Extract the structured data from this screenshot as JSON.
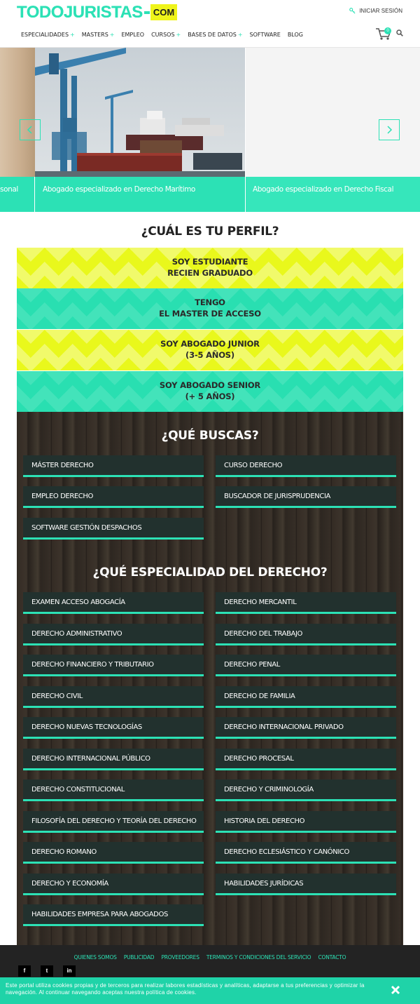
{
  "header": {
    "logo_main": "TODOJURISTAS",
    "logo_com": "COM",
    "login_label": "INICIAR SESIÓN",
    "cart_count": "0",
    "nav": [
      {
        "label": "ESPECIALIDADES",
        "plus": "+"
      },
      {
        "label": "MASTERS",
        "plus": "+"
      },
      {
        "label": "EMPLEO",
        "plus": ""
      },
      {
        "label": "CURSOS",
        "plus": "+"
      },
      {
        "label": "BASES DE DATOS",
        "plus": "+"
      },
      {
        "label": "SOFTWARE",
        "plus": ""
      },
      {
        "label": "BLOG",
        "plus": ""
      }
    ]
  },
  "slider": {
    "left_caption": "sonal",
    "main_caption": "Abogado especializado en Derecho Marítimo",
    "right_caption": "Abogado especializado en Derecho Fiscal"
  },
  "perfil": {
    "title": "¿CUÁL ES TU PERFIL?",
    "options": [
      {
        "line1": "SOY ESTUDIANTE",
        "line2": "RECIEN GRADUADO"
      },
      {
        "line1": "TENGO",
        "line2": "EL MASTER DE ACCESO"
      },
      {
        "line1": "SOY ABOGADO JUNIOR",
        "line2": "(3-5 AÑOS)"
      },
      {
        "line1": "SOY ABOGADO SENIOR",
        "line2": "(+ 5 AÑOS)"
      }
    ]
  },
  "buscas": {
    "title": "¿QUÉ BUSCAS?",
    "items": [
      "MÁSTER DERECHO",
      "CURSO DERECHO",
      "EMPLEO DERECHO",
      "BUSCADOR DE JURISPRUDENCIA",
      "SOFTWARE GESTIÓN DESPACHOS"
    ]
  },
  "especialidad": {
    "title": "¿QUÉ ESPECIALIDAD DEL DERECHO?",
    "items": [
      "EXAMEN ACCESO ABOGACÍA",
      "DERECHO MERCANTIL",
      "DERECHO ADMINISTRATIVO",
      "DERECHO DEL TRABAJO",
      "DERECHO FINANCIERO Y TRIBUTARIO",
      "DERECHO PENAL",
      "DERECHO CIVIL",
      "DERECHO DE FAMILIA",
      "DERECHO NUEVAS TECNOLOGÍAS",
      "DERECHO INTERNACIONAL PRIVADO",
      "DERECHO INTERNACIONAL PÚBLICO",
      "DERECHO PROCESAL",
      "DERECHO CONSTITUCIONAL",
      "DERECHO Y CRIMINOLOGÍA",
      "FILOSOFÍA DEL DERECHO Y TEORÍA DEL DERECHO",
      "HISTORIA DEL DERECHO",
      "DERECHO ROMANO",
      "DERECHO ECLESIÁSTICO Y CANÓNICO",
      "DERECHO Y ECONOMÍA",
      "HABILIDADES JURÍDICAS",
      "HABILIDADES EMPRESA PARA ABOGADOS"
    ]
  },
  "footer": {
    "links": [
      "QUIENES SOMOS",
      "PUBLICIDAD",
      "PROVEEDORES",
      "TERMINOS Y CONDICIONES DEL SERVICIO",
      "CONTACTO"
    ],
    "social": [
      {
        "icon": "facebook-icon",
        "glyph": "f"
      },
      {
        "icon": "twitter-icon",
        "glyph": "t"
      },
      {
        "icon": "linkedin-icon",
        "glyph": "in"
      }
    ]
  },
  "cookie": {
    "text": "Este portal utiliza cookies propias y de terceros para realizar labores estadísticas y analíticas, adaptarse a tus preferencias y optimizar la navegación. Al continuar navegando aceptas nuestra política de cookies."
  },
  "colors": {
    "accent": "#2ce1b5",
    "yellow": "#e9f81c",
    "dark_tile": "#22312e"
  }
}
